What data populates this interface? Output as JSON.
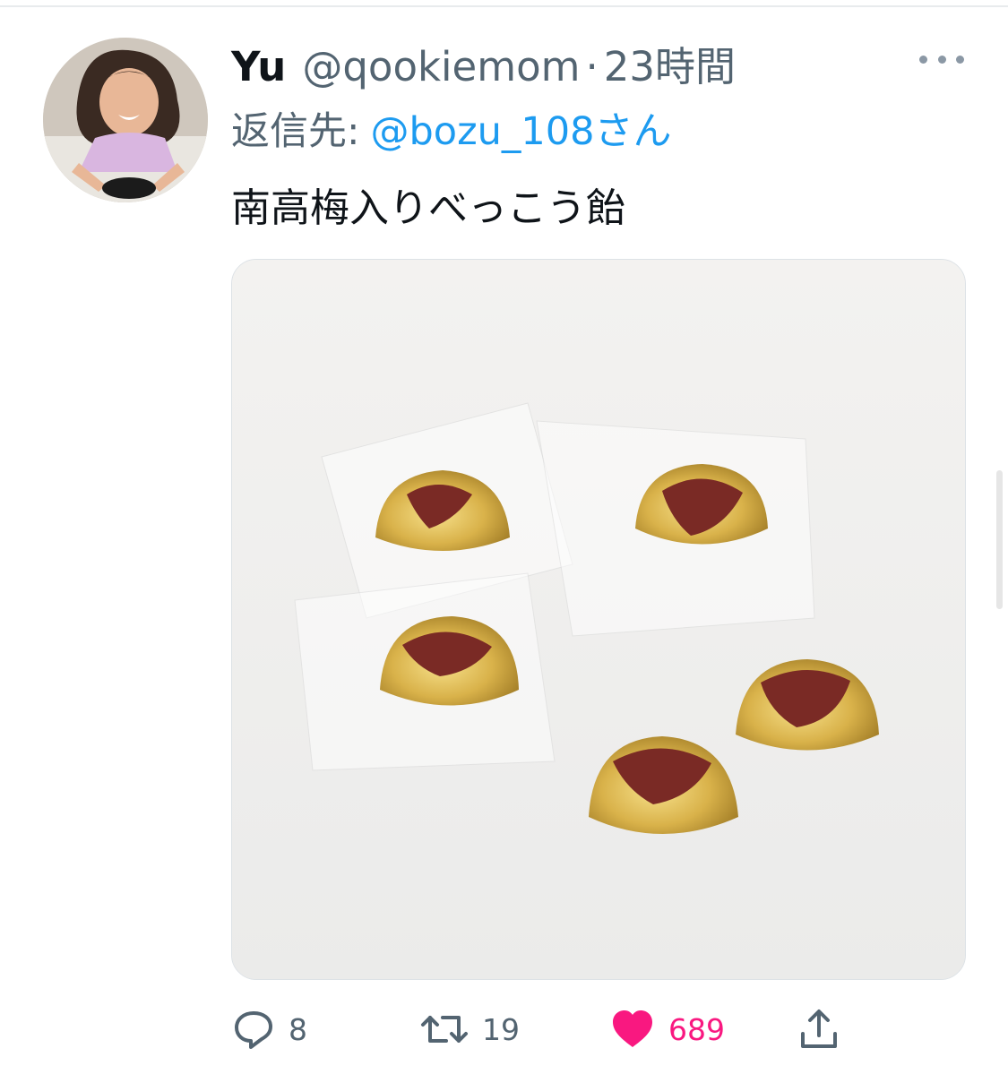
{
  "tweet": {
    "display_name": "Yu",
    "handle": "@qookiemom",
    "separator": "·",
    "time": "23時間",
    "reply_label": "返信先:",
    "reply_target": "@bozu_108さん",
    "text": "南高梅入りべっこう飴",
    "more_icon": "more-dots-icon"
  },
  "actions": {
    "reply": {
      "icon": "reply-bubble-icon",
      "count": "8"
    },
    "retweet": {
      "icon": "retweet-icon",
      "count": "19"
    },
    "like": {
      "icon": "heart-icon",
      "count": "689",
      "color": "#f91880"
    },
    "share": {
      "icon": "share-upload-icon"
    }
  },
  "colors": {
    "link": "#1d9bf0",
    "secondary_text": "#536471",
    "like_pink": "#f91880"
  }
}
